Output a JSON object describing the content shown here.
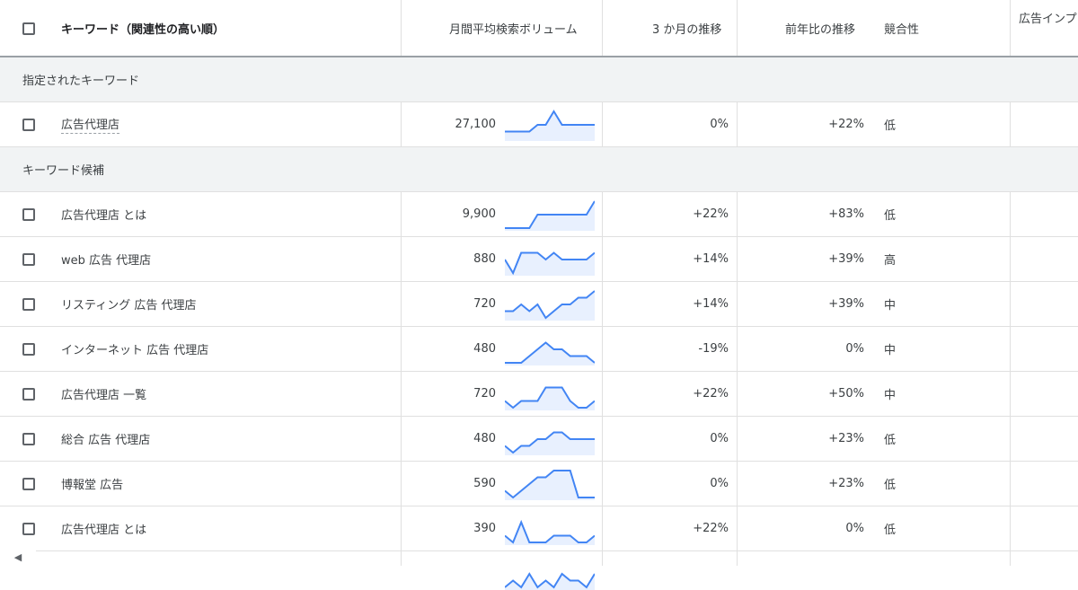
{
  "header": {
    "keyword": "キーワード（関連性の高い順）",
    "volume": "月間平均検索ボリューム",
    "three_month": "3 か月の推移",
    "yoy": "前年比の推移",
    "competition": "競合性",
    "impression": "広告インプ"
  },
  "groups": {
    "specified": "指定されたキーワード",
    "ideas": "キーワード候補"
  },
  "rows": [
    {
      "keyword": "広告代理店",
      "volume": "27,100",
      "three_month": "0%",
      "yoy": "+22%",
      "competition": "低",
      "trend": [
        2,
        2,
        2,
        2,
        3,
        3,
        5,
        3,
        3,
        3,
        3,
        3
      ]
    },
    {
      "keyword": "広告代理店 とは",
      "volume": "9,900",
      "three_month": "+22%",
      "yoy": "+83%",
      "competition": "低",
      "trend": [
        1,
        1,
        1,
        1,
        3,
        3,
        3,
        3,
        3,
        3,
        3,
        5
      ]
    },
    {
      "keyword": "web 広告 代理店",
      "volume": "880",
      "three_month": "+14%",
      "yoy": "+39%",
      "competition": "高",
      "trend": [
        3,
        1,
        4,
        4,
        4,
        3,
        4,
        3,
        3,
        3,
        3,
        4
      ]
    },
    {
      "keyword": "リスティング 広告 代理店",
      "volume": "720",
      "three_month": "+14%",
      "yoy": "+39%",
      "competition": "中",
      "trend": [
        2,
        2,
        3,
        2,
        3,
        1,
        2,
        3,
        3,
        4,
        4,
        5
      ]
    },
    {
      "keyword": "インターネット 広告 代理店",
      "volume": "480",
      "three_month": "-19%",
      "yoy": "0%",
      "competition": "中",
      "trend": [
        1,
        1,
        1,
        2,
        3,
        4,
        3,
        3,
        2,
        2,
        2,
        1
      ]
    },
    {
      "keyword": "広告代理店 一覧",
      "volume": "720",
      "three_month": "+22%",
      "yoy": "+50%",
      "competition": "中",
      "trend": [
        2,
        1,
        2,
        2,
        2,
        4,
        4,
        4,
        2,
        1,
        1,
        2
      ]
    },
    {
      "keyword": "総合 広告 代理店",
      "volume": "480",
      "three_month": "0%",
      "yoy": "+23%",
      "competition": "低",
      "trend": [
        2,
        1,
        2,
        2,
        3,
        3,
        4,
        4,
        3,
        3,
        3,
        3
      ]
    },
    {
      "keyword": "博報堂 広告",
      "volume": "590",
      "three_month": "0%",
      "yoy": "+23%",
      "competition": "低",
      "trend": [
        2,
        1,
        2,
        3,
        4,
        4,
        5,
        5,
        5,
        1,
        1,
        1
      ]
    },
    {
      "keyword": "広告代理店 とは",
      "volume": "390",
      "three_month": "+22%",
      "yoy": "0%",
      "competition": "低",
      "trend": [
        2,
        1,
        4,
        1,
        1,
        1,
        2,
        2,
        2,
        1,
        1,
        2
      ]
    }
  ],
  "partial_row": {
    "trend": [
      1,
      2,
      1,
      3,
      1,
      2,
      1,
      3,
      2,
      2,
      1,
      3
    ]
  },
  "colors": {
    "spark_line": "#4285f4",
    "spark_fill": "#e8f0fe",
    "group_bg": "#f1f3f4"
  },
  "icons": {
    "scroll_left": "◀"
  }
}
